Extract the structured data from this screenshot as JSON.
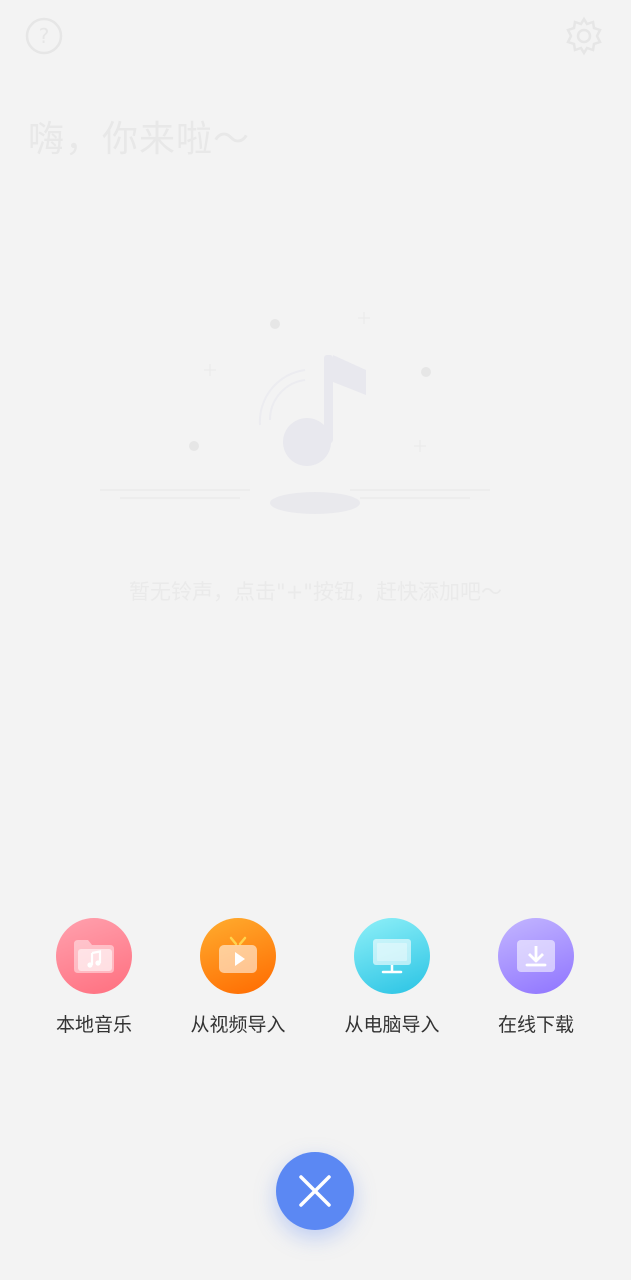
{
  "header": {
    "greeting": "嗨，你来啦～",
    "help_icon": "question-circle-icon",
    "settings_icon": "gear-icon"
  },
  "empty_state": {
    "message": "暂无铃声，点击\"+\"按钮，赶快添加吧～",
    "illustration_icon": "music-note-icon"
  },
  "actions": [
    {
      "label": "本地音乐",
      "icon": "folder-music-icon",
      "color": "#ff7f8e"
    },
    {
      "label": "从视频导入",
      "icon": "tv-play-icon",
      "color": "#ff8a10"
    },
    {
      "label": "从电脑导入",
      "icon": "monitor-icon",
      "color": "#3ccbe8"
    },
    {
      "label": "在线下载",
      "icon": "download-icon",
      "color": "#9c86ff"
    }
  ],
  "close_button": {
    "icon": "close-icon",
    "color": "#5b88f3"
  }
}
